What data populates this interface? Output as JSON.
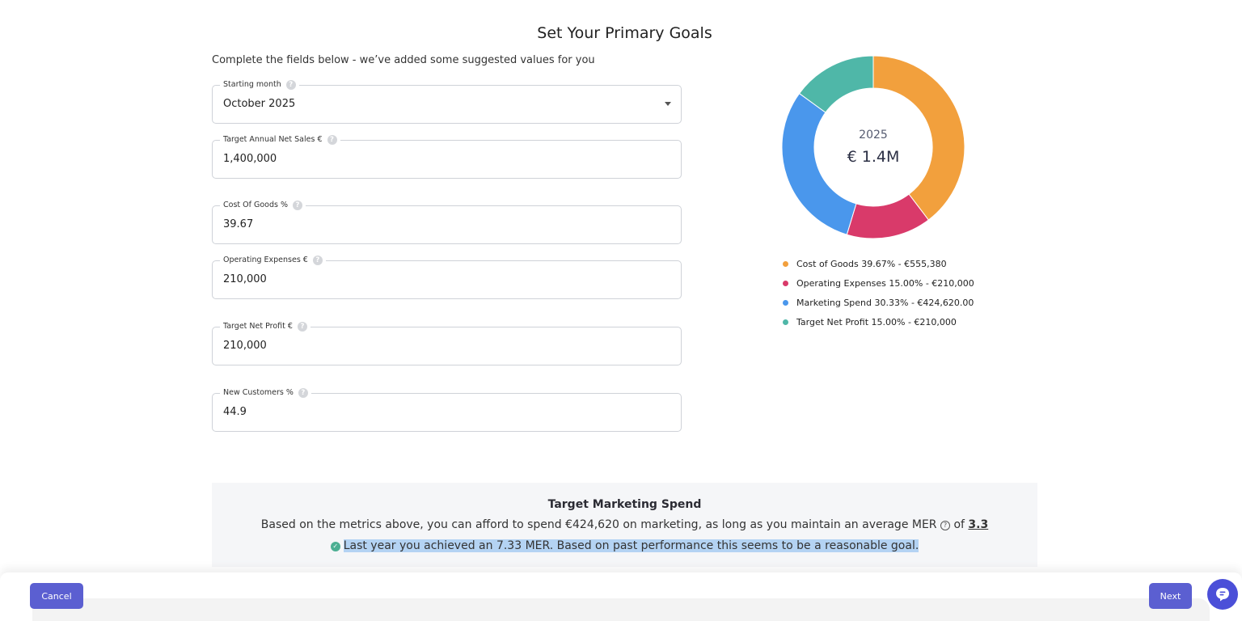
{
  "header": {
    "title": "Set Your Primary Goals",
    "subtitle": "Complete the fields below - we’ve added some suggested values for you"
  },
  "form": {
    "starting_month": {
      "label": "Starting month",
      "value": "October 2025"
    },
    "net_sales": {
      "label": "Target Annual Net Sales €",
      "value": "1,400,000"
    },
    "cost_of_goods": {
      "label": "Cost Of Goods %",
      "value": "39.67"
    },
    "operating_expenses": {
      "label": "Operating Expenses €",
      "value": "210,000"
    },
    "net_profit": {
      "label": "Target Net Profit €",
      "value": "210,000"
    },
    "new_customers": {
      "label": "New Customers %",
      "value": "44.9"
    }
  },
  "help_icon_glyph": "?",
  "donut": {
    "year": "2025",
    "total": "€ 1.4M"
  },
  "chart_data": {
    "type": "pie",
    "categories": [
      "Cost of Goods",
      "Operating Expenses",
      "Marketing Spend",
      "Target Net Profit"
    ],
    "values": [
      39.67,
      15.0,
      30.33,
      15.0
    ],
    "colors": [
      "#f2a03d",
      "#d93a6a",
      "#4a97ec",
      "#4fb7a8"
    ],
    "legend": [
      "Cost of Goods 39.67% - €555,380",
      "Operating Expenses 15.00% - €210,000",
      "Marketing Spend 30.33% - €424,620.00",
      "Target Net Profit 15.00% - €210,000"
    ],
    "legend_position": "below"
  },
  "marketing": {
    "title": "Target Marketing Spend",
    "text": "Based on the metrics above, you can afford to spend €424,620 on marketing, as long as you maintain an average MER",
    "of": "of",
    "mer_value": "3.3",
    "note": "Last year you achieved an 7.33 MER. Based on past performance this seems to be a reasonable goal."
  },
  "footer": {
    "cancel_label": "Cancel",
    "next_label": "Next"
  },
  "icons": {
    "help": "question-circle-icon",
    "check": "check-circle-icon",
    "chat": "chat-bubble-icon",
    "dropdown": "chevron-down-icon"
  }
}
